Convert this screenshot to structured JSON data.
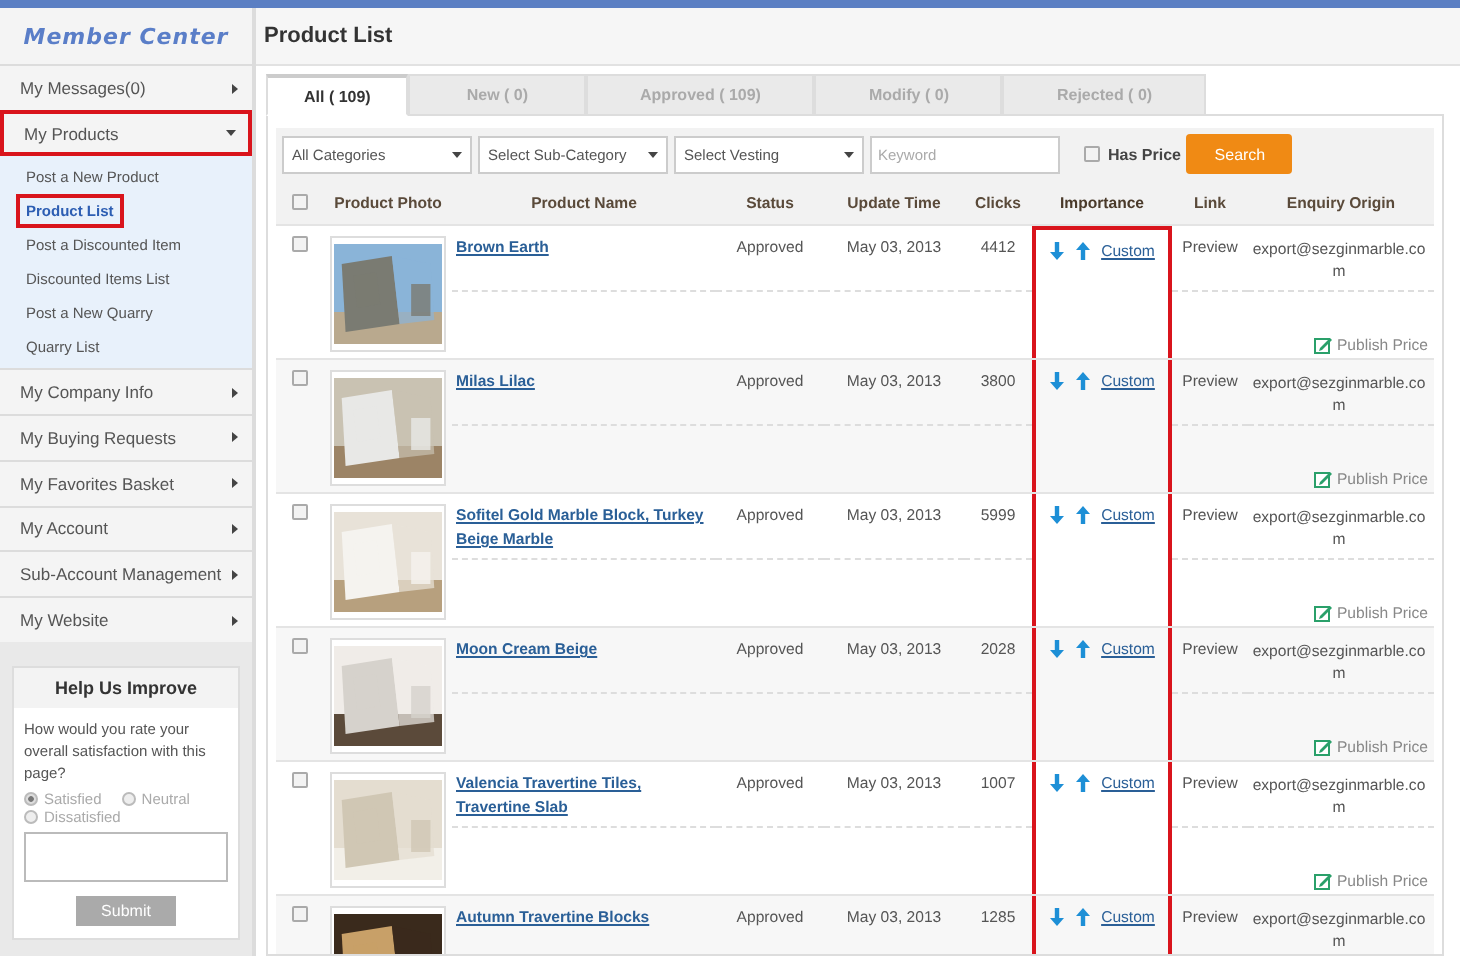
{
  "logo": "Member Center",
  "sidebar": {
    "items": [
      {
        "label": "My Messages(0)",
        "expanded": false,
        "highlighted": false
      },
      {
        "label": "My Products",
        "expanded": true,
        "highlighted": true,
        "children": [
          {
            "label": "Post a New Product",
            "selected": false,
            "highlighted": false
          },
          {
            "label": "Product List",
            "selected": true,
            "highlighted": true
          },
          {
            "label": "Post a Discounted Item",
            "selected": false,
            "highlighted": false
          },
          {
            "label": "Discounted Items List",
            "selected": false,
            "highlighted": false
          },
          {
            "label": "Post a New Quarry",
            "selected": false,
            "highlighted": false
          },
          {
            "label": "Quarry List",
            "selected": false,
            "highlighted": false
          }
        ]
      },
      {
        "label": "My Company Info",
        "expanded": false,
        "highlighted": false
      },
      {
        "label": "My Buying Requests",
        "expanded": false,
        "highlighted": false
      },
      {
        "label": "My Favorites Basket",
        "expanded": false,
        "highlighted": false
      },
      {
        "label": "My Account",
        "expanded": false,
        "highlighted": false
      },
      {
        "label": "Sub-Account Management",
        "expanded": false,
        "highlighted": false
      },
      {
        "label": "My Website",
        "expanded": false,
        "highlighted": false
      }
    ]
  },
  "feedback": {
    "title": "Help Us Improve",
    "question": "How would you rate your overall satisfaction with this page?",
    "options": [
      {
        "label": "Satisfied",
        "selected": true
      },
      {
        "label": "Neutral",
        "selected": false
      },
      {
        "label": "Dissatisfied",
        "selected": false
      }
    ],
    "submit": "Submit"
  },
  "page_title": "Product List",
  "tabs": [
    {
      "label": "All ( 109)",
      "selected": true
    },
    {
      "label": "New ( 0)",
      "selected": false
    },
    {
      "label": "Approved ( 109)",
      "selected": false
    },
    {
      "label": "Modify ( 0)",
      "selected": false
    },
    {
      "label": "Rejected ( 0)",
      "selected": false
    }
  ],
  "filters": {
    "selects": [
      "All Categories",
      "Select Sub-Category",
      "Select Vesting"
    ],
    "keyword": {
      "placeholder": "Keyword"
    },
    "has_price": {
      "label": "Has Price",
      "checked": false
    },
    "search_button": "Search"
  },
  "table": {
    "select_all": false,
    "columns": [
      {
        "label": "Product Photo",
        "highlighted": false
      },
      {
        "label": "Product Name",
        "highlighted": false
      },
      {
        "label": "Status",
        "highlighted": false
      },
      {
        "label": "Update Time",
        "highlighted": false
      },
      {
        "label": "Clicks",
        "highlighted": false
      },
      {
        "label": "Importance",
        "highlighted": true
      },
      {
        "label": "Link",
        "highlighted": false
      },
      {
        "label": "Enquiry Origin",
        "highlighted": false
      }
    ],
    "rows": [
      {
        "checked": false,
        "name": "Brown Earth",
        "status": "Approved",
        "updated": "May 03, 2013",
        "clicks": "4412",
        "custom": "Custom",
        "link": "Preview",
        "enquiry_origin": "export@sezginmarble.com",
        "publish_price": "Publish Price"
      },
      {
        "checked": false,
        "name": "Milas Lilac",
        "status": "Approved",
        "updated": "May 03, 2013",
        "clicks": "3800",
        "custom": "Custom",
        "link": "Preview",
        "enquiry_origin": "export@sezginmarble.com",
        "publish_price": "Publish Price"
      },
      {
        "checked": false,
        "name": "Sofitel Gold Marble Block, Turkey Beige Marble",
        "status": "Approved",
        "updated": "May 03, 2013",
        "clicks": "5999",
        "custom": "Custom",
        "link": "Preview",
        "enquiry_origin": "export@sezginmarble.com",
        "publish_price": "Publish Price"
      },
      {
        "checked": false,
        "name": "Moon Cream Beige",
        "status": "Approved",
        "updated": "May 03, 2013",
        "clicks": "2028",
        "custom": "Custom",
        "link": "Preview",
        "enquiry_origin": "export@sezginmarble.com",
        "publish_price": "Publish Price"
      },
      {
        "checked": false,
        "name": "Valencia Travertine Tiles, Travertine Slab",
        "status": "Approved",
        "updated": "May 03, 2013",
        "clicks": "1007",
        "custom": "Custom",
        "link": "Preview",
        "enquiry_origin": "export@sezginmarble.com",
        "publish_price": "Publish Price"
      },
      {
        "checked": false,
        "name": "Autumn Travertine Blocks",
        "status": "Approved",
        "updated": "May 03, 2013",
        "clicks": "1285",
        "custom": "Custom",
        "link": "Preview",
        "enquiry_origin": "export@sezginmarble.com"
      }
    ]
  }
}
